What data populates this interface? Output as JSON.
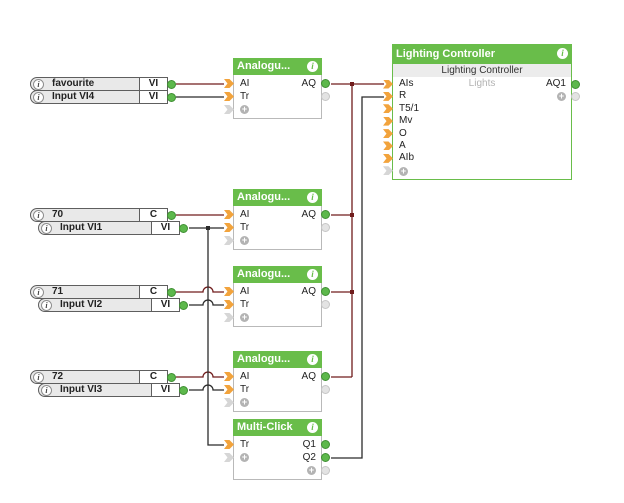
{
  "colors": {
    "block-green": "#69bd4a",
    "wire-analog": "#701c1c",
    "wire-digital": "#2b2b2b",
    "connector-orange": "#f2a33c",
    "nub-green": "#5db84c",
    "inactive": "#d6d6d6"
  },
  "icons": {
    "info": "i",
    "plus": "+"
  },
  "input_connectors": [
    {
      "label": "favourite",
      "tag": "VI"
    },
    {
      "label": "Input VI4",
      "tag": "VI"
    },
    {
      "label": "70",
      "tag": "C"
    },
    {
      "label": "Input VI1",
      "tag": "VI"
    },
    {
      "label": "71",
      "tag": "C"
    },
    {
      "label": "Input VI2",
      "tag": "VI"
    },
    {
      "label": "72",
      "tag": "C"
    },
    {
      "label": "Input VI3",
      "tag": "VI"
    }
  ],
  "blocks": {
    "analogue1": {
      "title": "Analogu...",
      "inputs": [
        "AI",
        "Tr"
      ],
      "outputs": [
        "AQ"
      ]
    },
    "analogue2": {
      "title": "Analogu...",
      "inputs": [
        "AI",
        "Tr"
      ],
      "outputs": [
        "AQ"
      ]
    },
    "analogue3": {
      "title": "Analogu...",
      "inputs": [
        "AI",
        "Tr"
      ],
      "outputs": [
        "AQ"
      ]
    },
    "analogue4": {
      "title": "Analogu...",
      "inputs": [
        "AI",
        "Tr"
      ],
      "outputs": [
        "AQ"
      ]
    },
    "multiclick": {
      "title": "Multi-Click",
      "inputs": [
        "Tr"
      ],
      "outputs": [
        "Q1",
        "Q2"
      ]
    },
    "lighting": {
      "title": "Lighting Controller",
      "subtitle": "Lighting Controller",
      "category": "Lights",
      "inputs": [
        "AIs",
        "R",
        "T5/1",
        "Mv",
        "O",
        "A",
        "AIb"
      ],
      "outputs": [
        "AQ1"
      ]
    }
  }
}
